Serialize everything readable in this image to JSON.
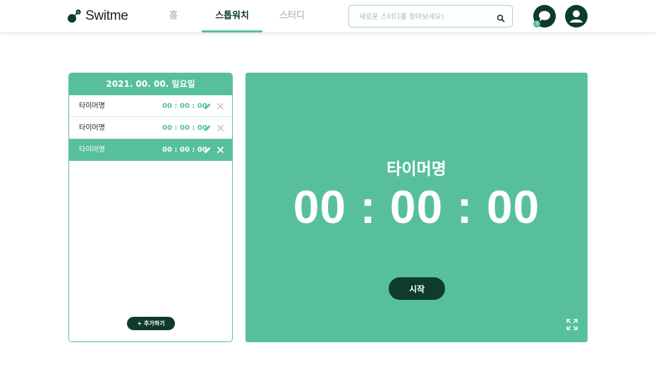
{
  "brand": {
    "name": "Switme"
  },
  "nav": {
    "tabs": [
      {
        "label": "홈"
      },
      {
        "label": "스톱워치"
      },
      {
        "label": "스터디"
      }
    ],
    "active": "스톱워치"
  },
  "search": {
    "placeholder": "새로운 스터디를 찾아보세요!",
    "value": "",
    "icon": "search-icon"
  },
  "header_actions": {
    "chat_icon": "chat-bubble-icon",
    "chat_badge": "3",
    "profile_icon": "user-icon"
  },
  "timer_list": {
    "date": "2021. 00. 00. 일요일",
    "items": [
      {
        "name": "타이머명",
        "time": "00 : 00 : 00",
        "active": false
      },
      {
        "name": "타이머명",
        "time": "00 : 00 : 00",
        "active": false
      },
      {
        "name": "타이머명",
        "time": "00 : 00 : 00",
        "active": true
      }
    ],
    "add_label": "+ 추가하기"
  },
  "main_timer": {
    "name": "타이머명",
    "time": "00 : 00 : 00",
    "start_label": "시작",
    "fullscreen_icon": "expand-icon"
  },
  "colors": {
    "accent": "#57c09b",
    "dark": "#0f3b2c",
    "muted": "#c0c0c0"
  }
}
